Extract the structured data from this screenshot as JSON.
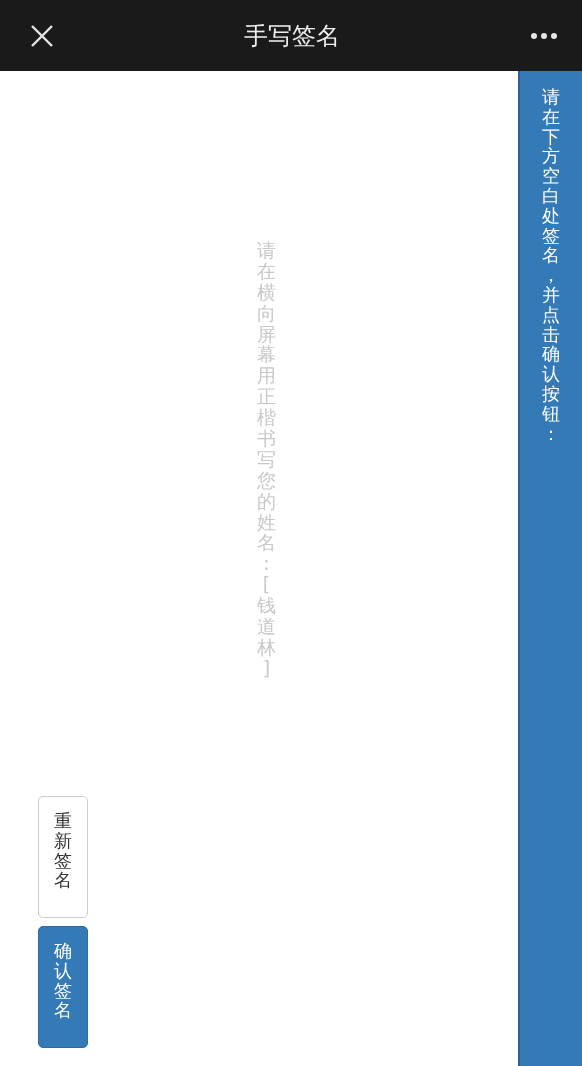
{
  "window": {
    "title": "手写签名"
  },
  "banner": {
    "text": "请在下方空白处签名，并点击确认按钮："
  },
  "canvas": {
    "hint": "请在横向屏幕用正楷书写您的姓名:[钱道林]"
  },
  "buttons": [
    {
      "label": "重新签名",
      "kind": "secondary"
    },
    {
      "label": "确认签名",
      "kind": "primary"
    }
  ]
}
